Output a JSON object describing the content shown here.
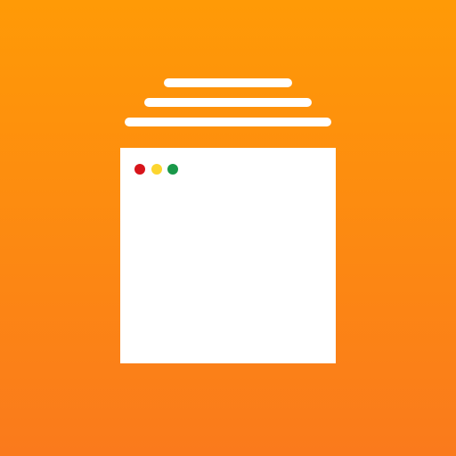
{
  "icon": {
    "name": "stacked-browser-windows",
    "background_colors": [
      "#ff9a06",
      "#fa7a1c"
    ],
    "foreground_color": "#ffffff",
    "stacked_window_lines": 3,
    "traffic_lights": [
      {
        "name": "close",
        "color": "#d7141b"
      },
      {
        "name": "minimize",
        "color": "#fcd52f"
      },
      {
        "name": "zoom",
        "color": "#199849"
      }
    ]
  }
}
